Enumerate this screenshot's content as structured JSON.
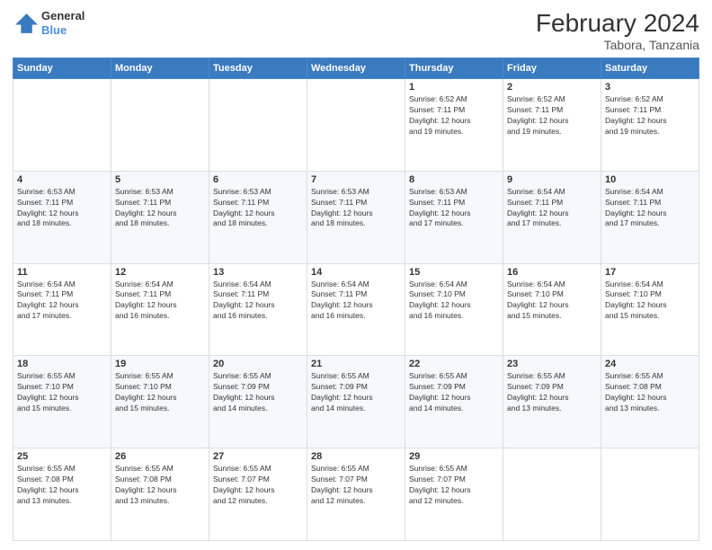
{
  "header": {
    "logo": {
      "general": "General",
      "blue": "Blue"
    },
    "title": "February 2024",
    "subtitle": "Tabora, Tanzania"
  },
  "calendar": {
    "days_of_week": [
      "Sunday",
      "Monday",
      "Tuesday",
      "Wednesday",
      "Thursday",
      "Friday",
      "Saturday"
    ],
    "weeks": [
      [
        {
          "day": "",
          "info": ""
        },
        {
          "day": "",
          "info": ""
        },
        {
          "day": "",
          "info": ""
        },
        {
          "day": "",
          "info": ""
        },
        {
          "day": "1",
          "info": "Sunrise: 6:52 AM\nSunset: 7:11 PM\nDaylight: 12 hours\nand 19 minutes."
        },
        {
          "day": "2",
          "info": "Sunrise: 6:52 AM\nSunset: 7:11 PM\nDaylight: 12 hours\nand 19 minutes."
        },
        {
          "day": "3",
          "info": "Sunrise: 6:52 AM\nSunset: 7:11 PM\nDaylight: 12 hours\nand 19 minutes."
        }
      ],
      [
        {
          "day": "4",
          "info": "Sunrise: 6:53 AM\nSunset: 7:11 PM\nDaylight: 12 hours\nand 18 minutes."
        },
        {
          "day": "5",
          "info": "Sunrise: 6:53 AM\nSunset: 7:11 PM\nDaylight: 12 hours\nand 18 minutes."
        },
        {
          "day": "6",
          "info": "Sunrise: 6:53 AM\nSunset: 7:11 PM\nDaylight: 12 hours\nand 18 minutes."
        },
        {
          "day": "7",
          "info": "Sunrise: 6:53 AM\nSunset: 7:11 PM\nDaylight: 12 hours\nand 18 minutes."
        },
        {
          "day": "8",
          "info": "Sunrise: 6:53 AM\nSunset: 7:11 PM\nDaylight: 12 hours\nand 17 minutes."
        },
        {
          "day": "9",
          "info": "Sunrise: 6:54 AM\nSunset: 7:11 PM\nDaylight: 12 hours\nand 17 minutes."
        },
        {
          "day": "10",
          "info": "Sunrise: 6:54 AM\nSunset: 7:11 PM\nDaylight: 12 hours\nand 17 minutes."
        }
      ],
      [
        {
          "day": "11",
          "info": "Sunrise: 6:54 AM\nSunset: 7:11 PM\nDaylight: 12 hours\nand 17 minutes."
        },
        {
          "day": "12",
          "info": "Sunrise: 6:54 AM\nSunset: 7:11 PM\nDaylight: 12 hours\nand 16 minutes."
        },
        {
          "day": "13",
          "info": "Sunrise: 6:54 AM\nSunset: 7:11 PM\nDaylight: 12 hours\nand 16 minutes."
        },
        {
          "day": "14",
          "info": "Sunrise: 6:54 AM\nSunset: 7:11 PM\nDaylight: 12 hours\nand 16 minutes."
        },
        {
          "day": "15",
          "info": "Sunrise: 6:54 AM\nSunset: 7:10 PM\nDaylight: 12 hours\nand 16 minutes."
        },
        {
          "day": "16",
          "info": "Sunrise: 6:54 AM\nSunset: 7:10 PM\nDaylight: 12 hours\nand 15 minutes."
        },
        {
          "day": "17",
          "info": "Sunrise: 6:54 AM\nSunset: 7:10 PM\nDaylight: 12 hours\nand 15 minutes."
        }
      ],
      [
        {
          "day": "18",
          "info": "Sunrise: 6:55 AM\nSunset: 7:10 PM\nDaylight: 12 hours\nand 15 minutes."
        },
        {
          "day": "19",
          "info": "Sunrise: 6:55 AM\nSunset: 7:10 PM\nDaylight: 12 hours\nand 15 minutes."
        },
        {
          "day": "20",
          "info": "Sunrise: 6:55 AM\nSunset: 7:09 PM\nDaylight: 12 hours\nand 14 minutes."
        },
        {
          "day": "21",
          "info": "Sunrise: 6:55 AM\nSunset: 7:09 PM\nDaylight: 12 hours\nand 14 minutes."
        },
        {
          "day": "22",
          "info": "Sunrise: 6:55 AM\nSunset: 7:09 PM\nDaylight: 12 hours\nand 14 minutes."
        },
        {
          "day": "23",
          "info": "Sunrise: 6:55 AM\nSunset: 7:09 PM\nDaylight: 12 hours\nand 13 minutes."
        },
        {
          "day": "24",
          "info": "Sunrise: 6:55 AM\nSunset: 7:08 PM\nDaylight: 12 hours\nand 13 minutes."
        }
      ],
      [
        {
          "day": "25",
          "info": "Sunrise: 6:55 AM\nSunset: 7:08 PM\nDaylight: 12 hours\nand 13 minutes."
        },
        {
          "day": "26",
          "info": "Sunrise: 6:55 AM\nSunset: 7:08 PM\nDaylight: 12 hours\nand 13 minutes."
        },
        {
          "day": "27",
          "info": "Sunrise: 6:55 AM\nSunset: 7:07 PM\nDaylight: 12 hours\nand 12 minutes."
        },
        {
          "day": "28",
          "info": "Sunrise: 6:55 AM\nSunset: 7:07 PM\nDaylight: 12 hours\nand 12 minutes."
        },
        {
          "day": "29",
          "info": "Sunrise: 6:55 AM\nSunset: 7:07 PM\nDaylight: 12 hours\nand 12 minutes."
        },
        {
          "day": "",
          "info": ""
        },
        {
          "day": "",
          "info": ""
        }
      ]
    ]
  }
}
